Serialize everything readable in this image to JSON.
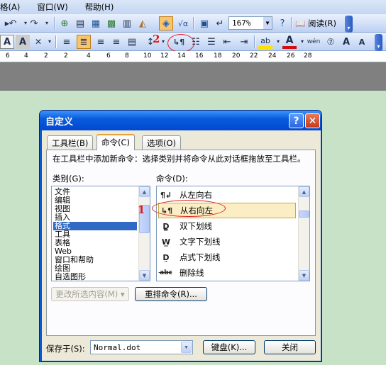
{
  "menubar": {
    "items": [
      "格(A)",
      "窗口(W)",
      "帮助(H)"
    ]
  },
  "toolbar": {
    "zoom": "167%",
    "read_label": "阅读(R)"
  },
  "annotations": {
    "one": "1",
    "two": "2"
  },
  "ruler": {
    "numbers": [
      "6",
      "4",
      "2",
      "2",
      "4",
      "6",
      "8",
      "10",
      "12",
      "14",
      "16",
      "18",
      "20",
      "22",
      "24",
      "26",
      "28"
    ]
  },
  "dialog": {
    "title": "自定义",
    "tabs": [
      "工具栏(B)",
      "命令(C)",
      "选项(O)"
    ],
    "description": "在工具栏中添加新命令：选择类别并将命令从此对话框拖放至工具栏。",
    "categories_label": "类别(G):",
    "commands_label": "命令(D):",
    "categories": [
      "文件",
      "编辑",
      "视图",
      "插入",
      "格式",
      "工具",
      "表格",
      "Web",
      "窗口和帮助",
      "绘图",
      "自选图形"
    ],
    "selected_category": "格式",
    "commands": [
      {
        "icon": "left-to-right-icon",
        "glyph": "¶↲",
        "label": "从左向右"
      },
      {
        "icon": "right-to-left-icon",
        "glyph": "↳¶",
        "label": "从右向左"
      },
      {
        "icon": "double-underline-icon",
        "glyph": "D̳",
        "label": "双下划线"
      },
      {
        "icon": "word-underline-icon",
        "glyph": "W̲",
        "label": "文字下划线"
      },
      {
        "icon": "dotted-underline-icon",
        "glyph": "D̤",
        "label": "点式下划线"
      },
      {
        "icon": "strikethrough-icon",
        "glyph": "a̶b̶c̶",
        "label": "删除线"
      }
    ],
    "modify_selection": "更改所选内容(M) ▾",
    "rearrange": "重排命令(R)...",
    "save_in_label": "保存于(S):",
    "save_in_value": "Normal.dot",
    "keyboard": "键盘(K)...",
    "close": "关闭"
  }
}
